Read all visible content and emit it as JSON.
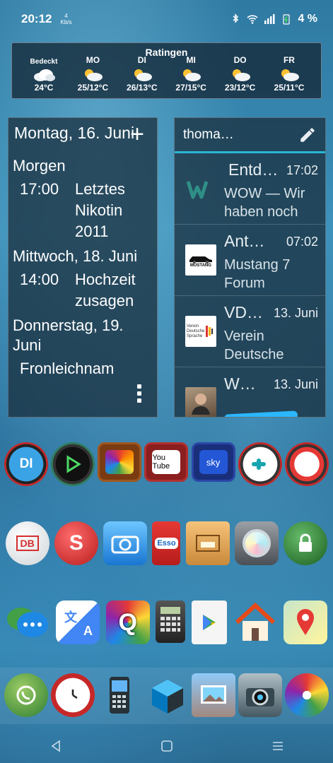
{
  "status": {
    "time": "20:12",
    "speed_num": "4",
    "speed_unit": "Kb/s",
    "battery": "4 %"
  },
  "weather": {
    "location": "Ratingen",
    "days": [
      {
        "day": "Bedeckt",
        "temp": "24°C",
        "icon": "overcast-icon"
      },
      {
        "day": "MO",
        "temp": "25/12°C",
        "icon": "partly-cloudy-icon"
      },
      {
        "day": "DI",
        "temp": "26/13°C",
        "icon": "partly-cloudy-icon"
      },
      {
        "day": "MI",
        "temp": "27/15°C",
        "icon": "partly-cloudy-icon"
      },
      {
        "day": "DO",
        "temp": "23/12°C",
        "icon": "partly-cloudy-icon"
      },
      {
        "day": "FR",
        "temp": "25/11°C",
        "icon": "partly-cloudy-icon"
      }
    ]
  },
  "agenda": {
    "header": "Montag, 16. Juni",
    "add": "+",
    "sections": [
      {
        "day": "Morgen",
        "time": "17:00",
        "title": "Letztes Nikotin 2011"
      },
      {
        "day": "Mittwoch, 18. Juni",
        "time": "14:00",
        "title": "Hochzeit zusagen"
      },
      {
        "day": "Donnerstag, 19. Juni",
        "time": "",
        "title": "Fronleichnam"
      }
    ]
  },
  "mail": {
    "account": "thoma…",
    "items": [
      {
        "sender": "Entd…",
        "time": "17:02",
        "subject": "WOW — Wir haben noch"
      },
      {
        "sender": "Ant…",
        "time": "07:02",
        "subject": "Mustang 7 Forum"
      },
      {
        "sender": "VD…",
        "time": "13. Juni",
        "subject": "Verein Deutsche"
      },
      {
        "sender": "W…",
        "time": "13. Juni",
        "subject": ""
      }
    ]
  },
  "apps_row1": [
    "DI",
    "Music",
    "Discovery",
    "YouTube",
    "sky",
    "Player",
    "Video"
  ],
  "apps_row2": [
    "DB",
    "S",
    "Camera",
    "Esso",
    "Files",
    "Disc",
    "Lock"
  ],
  "apps_row3": [
    "Messages",
    "Translate",
    "Q",
    "Calculator",
    "Play",
    "Home",
    "Maps"
  ],
  "dock": [
    "WhatsApp",
    "Clock",
    "Phone",
    "Cube",
    "Gallery",
    "Camera",
    "Gallery2"
  ],
  "logos": {
    "db": "DB",
    "esso": "Esso",
    "youtube": "You Tube",
    "sky": "sky",
    "mustang": "MUSTANG",
    "vds": "Verein Deutsche Sprache"
  }
}
